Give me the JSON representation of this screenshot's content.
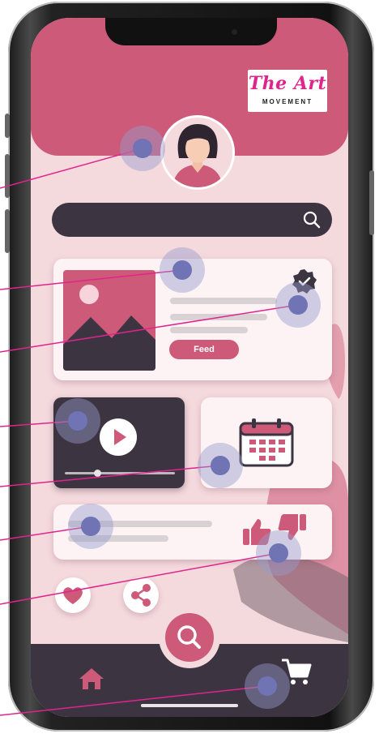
{
  "logo": {
    "title": "The Art",
    "subtitle": "MOVEMENT"
  },
  "search": {
    "icon": "search-icon"
  },
  "feed_card": {
    "button_label": "Feed",
    "verified_icon": "verified-badge-icon",
    "image_icon": "image-placeholder-icon"
  },
  "video_card": {
    "icon": "play-icon",
    "progress": 0.3
  },
  "calendar_card": {
    "icon": "calendar-icon"
  },
  "rating_card": {
    "icons": [
      "thumbs-up-icon",
      "thumbs-down-icon"
    ]
  },
  "actions": {
    "icons": [
      "heart-icon",
      "share-icon"
    ]
  },
  "nav": {
    "icons": [
      "home-icon",
      "search-icon",
      "cart-icon"
    ]
  },
  "colors": {
    "brand_pink": "#cc5a78",
    "dark": "#3d3442",
    "bg_pink": "#f4d9dd",
    "logo_magenta": "#e0248e",
    "highlight": "#7074b5",
    "callout_line": "#e0248e"
  }
}
